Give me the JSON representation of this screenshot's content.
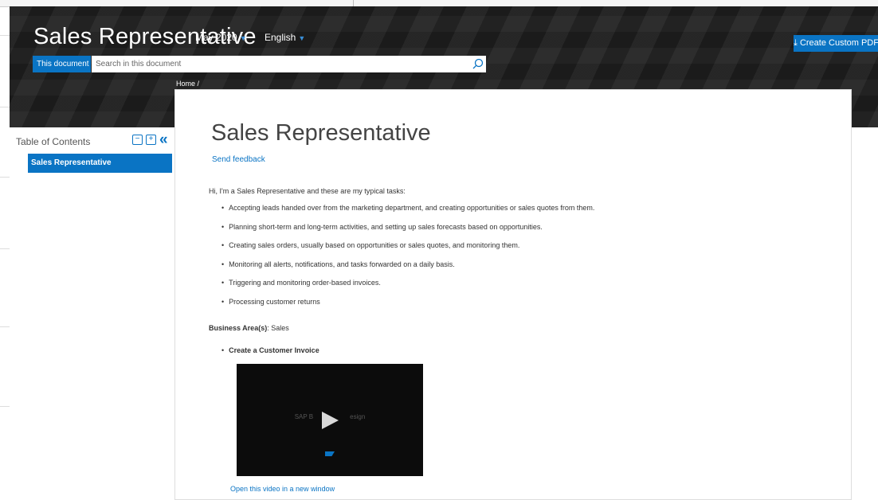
{
  "header": {
    "title": "Sales Representative",
    "version": "May 2020",
    "language": "English",
    "create_pdf_label": "Create Custom PDF"
  },
  "search": {
    "scope_label": "This document",
    "placeholder": "Search in this document"
  },
  "breadcrumb": "Home /",
  "toc": {
    "title": "Table of Contents",
    "items": [
      {
        "label": "Sales Representative",
        "selected": true
      }
    ]
  },
  "content": {
    "title": "Sales Representative",
    "feedback_label": "Send feedback",
    "intro": "Hi, I'm a Sales Representative and these are my typical tasks:",
    "tasks": [
      "Accepting leads handed over from the marketing department, and creating opportunities or sales quotes from them.",
      "Planning short-term and long-term activities, and setting up sales forecasts based on opportunities.",
      "Creating sales orders, usually based on opportunities or sales quotes, and monitoring them.",
      "Monitoring all alerts, notifications, and tasks forwarded on a daily basis.",
      "Triggering and monitoring order-based invoices.",
      "Processing customer returns"
    ],
    "business_area_label": "Business Area(s)",
    "business_area_value": ": Sales",
    "sub_item": "Create a Customer Invoice",
    "video_caption": "SAP B",
    "video_caption_right": "esign",
    "video_link": "Open this video in a new window"
  },
  "colors": {
    "accent": "#0a74c4",
    "header_bg": "#1b1b1b"
  }
}
